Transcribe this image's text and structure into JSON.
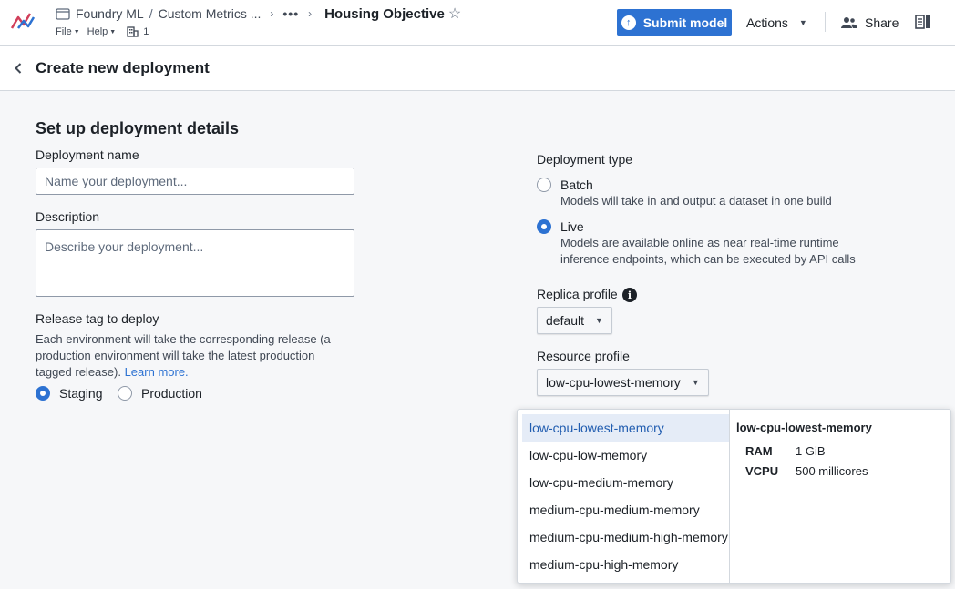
{
  "topbar": {
    "breadcrumbs": [
      "Foundry ML",
      "Custom Metrics ...",
      "•••",
      "Housing Objective"
    ],
    "star_glyph": "☆",
    "menus": [
      "File",
      "Help"
    ],
    "people_count": "1",
    "submit_label": "Submit model",
    "actions_label": "Actions",
    "share_label": "Share"
  },
  "page": {
    "title": "Create new deployment"
  },
  "form": {
    "section_title": "Set up deployment details",
    "name_label": "Deployment name",
    "name_placeholder": "Name your deployment...",
    "name_value": "",
    "description_label": "Description",
    "description_placeholder": "Describe your deployment...",
    "description_value": "",
    "release_label": "Release tag to deploy",
    "release_help": "Each environment will take the corresponding release (a production environment will take the latest production tagged release).",
    "release_help_link": "Learn more.",
    "release_options": [
      {
        "label": "Staging",
        "checked": true
      },
      {
        "label": "Production",
        "checked": false
      }
    ],
    "deployment_type_label": "Deployment type",
    "deployment_types": [
      {
        "label": "Batch",
        "description": "Models will take in and output a dataset in one build",
        "checked": false
      },
      {
        "label": "Live",
        "description": "Models are available online as near real-time runtime inference endpoints, which can be executed by API calls",
        "checked": true
      }
    ],
    "replica_label": "Replica profile",
    "replica_value": "default",
    "resource_label": "Resource profile",
    "resource_value": "low-cpu-lowest-memory"
  },
  "dropdown": {
    "options": [
      "low-cpu-lowest-memory",
      "low-cpu-low-memory",
      "low-cpu-medium-memory",
      "medium-cpu-medium-memory",
      "medium-cpu-medium-high-memory",
      "medium-cpu-high-memory"
    ],
    "active_index": 0,
    "detail": {
      "title": "low-cpu-lowest-memory",
      "specs": [
        {
          "key": "RAM",
          "value": "1 GiB"
        },
        {
          "key": "VCPU",
          "value": "500 millicores"
        }
      ]
    }
  },
  "colors": {
    "accent": "#2d72d2",
    "active_item_bg": "#e5ecf7",
    "page_bg": "#f6f7f9"
  }
}
